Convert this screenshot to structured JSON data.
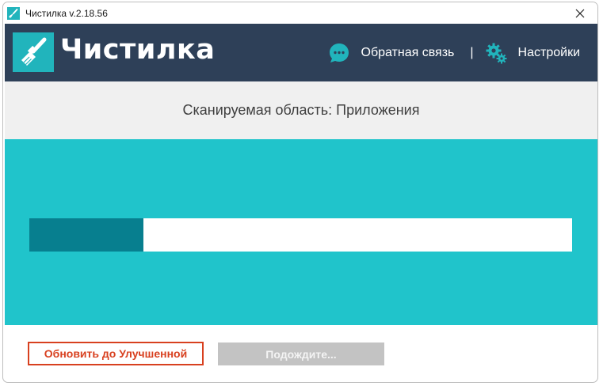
{
  "window": {
    "title": "Чистилка v.2.18.56"
  },
  "header": {
    "logo_text": "Чистилка",
    "feedback_label": "Обратная связь",
    "separator": "|",
    "settings_label": "Настройки"
  },
  "scan": {
    "label": "Сканируемая область: Приложения",
    "progress_fraction": 0.21
  },
  "footer": {
    "upgrade_label": "Обновить до Улучшенной",
    "wait_label": "Подождите..."
  },
  "colors": {
    "header_bg": "#2e4058",
    "accent_teal": "#21b4bc",
    "progress_bg": "#20c4cb",
    "progress_fill": "#077f8f",
    "upgrade_red": "#d8401f",
    "disabled_gray": "#c3c3c3"
  },
  "icons": {
    "app": "broom-icon",
    "close": "close-icon",
    "feedback": "chat-bubble-icon",
    "settings": "gears-icon",
    "logo": "broom-icon"
  }
}
